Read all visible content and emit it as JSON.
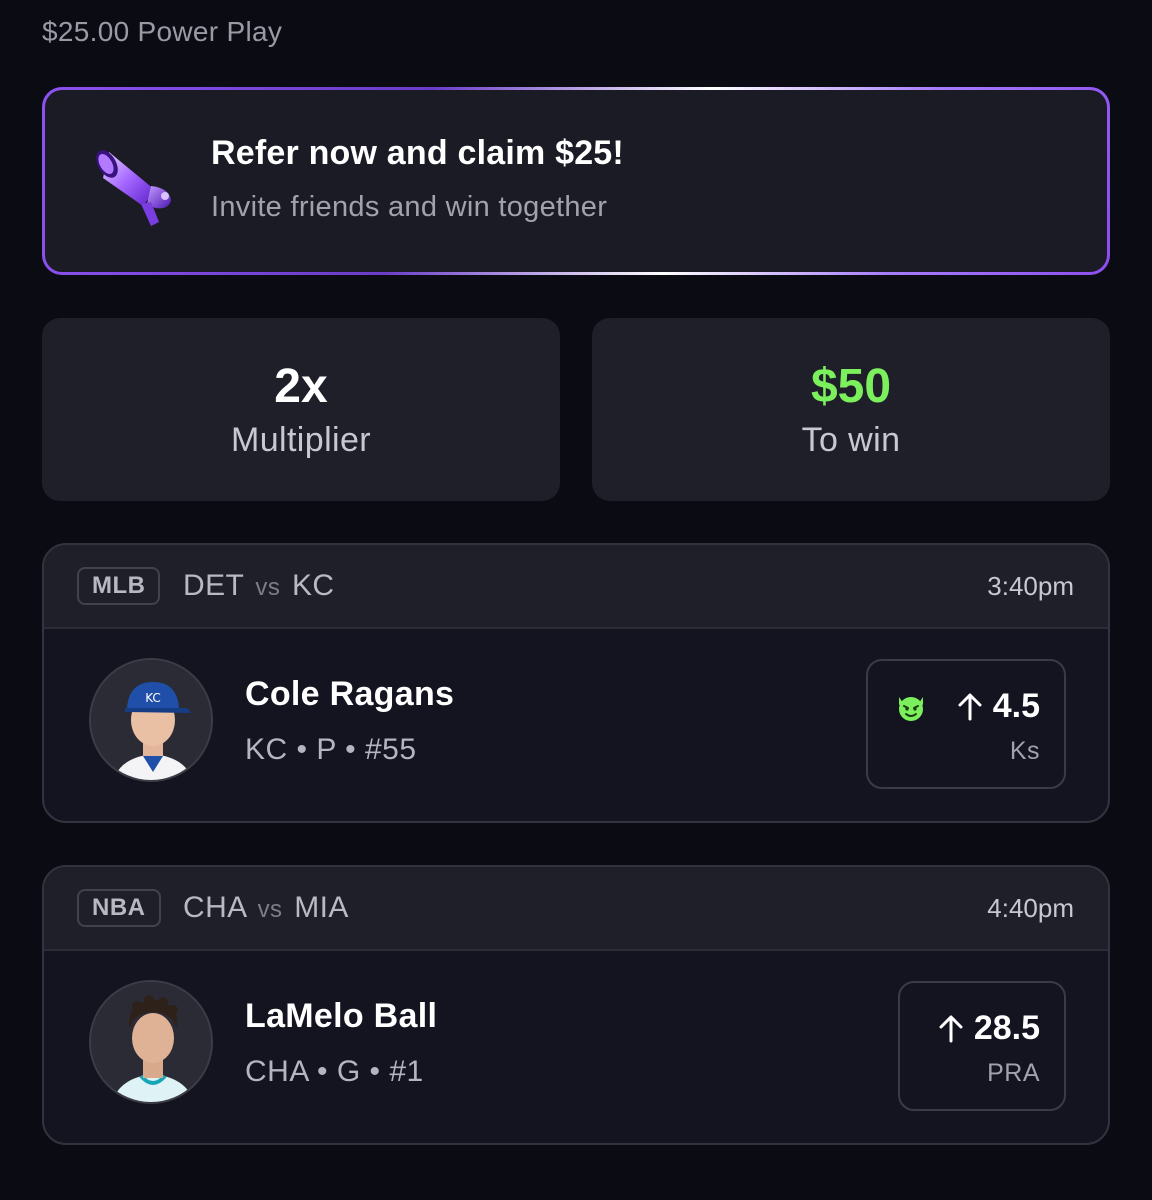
{
  "entry": {
    "title": "$25.00 Power Play"
  },
  "banner": {
    "title": "Refer now and claim $25!",
    "subtitle": "Invite friends and win together",
    "icon": "megaphone-icon"
  },
  "stats": {
    "multiplier_value": "2x",
    "multiplier_label": "Multiplier",
    "to_win_value": "$50",
    "to_win_label": "To win",
    "to_win_color": "#7cf05c"
  },
  "picks": [
    {
      "league": "MLB",
      "away": "DET",
      "vs": "vs",
      "home": "KC",
      "time": "3:40pm",
      "player_name": "Cole Ragans",
      "player_meta": "KC • P • #55",
      "direction": "up",
      "line": "4.5",
      "stat_type": "Ks",
      "badge_icon": "demon-icon"
    },
    {
      "league": "NBA",
      "away": "CHA",
      "vs": "vs",
      "home": "MIA",
      "time": "4:40pm",
      "player_name": "LaMelo Ball",
      "player_meta": "CHA • G • #1",
      "direction": "up",
      "line": "28.5",
      "stat_type": "PRA"
    }
  ],
  "colors": {
    "background": "#0b0b13",
    "card": "#1f1f2a",
    "accent_purple": "#8d52f2",
    "green": "#7cf05c"
  }
}
